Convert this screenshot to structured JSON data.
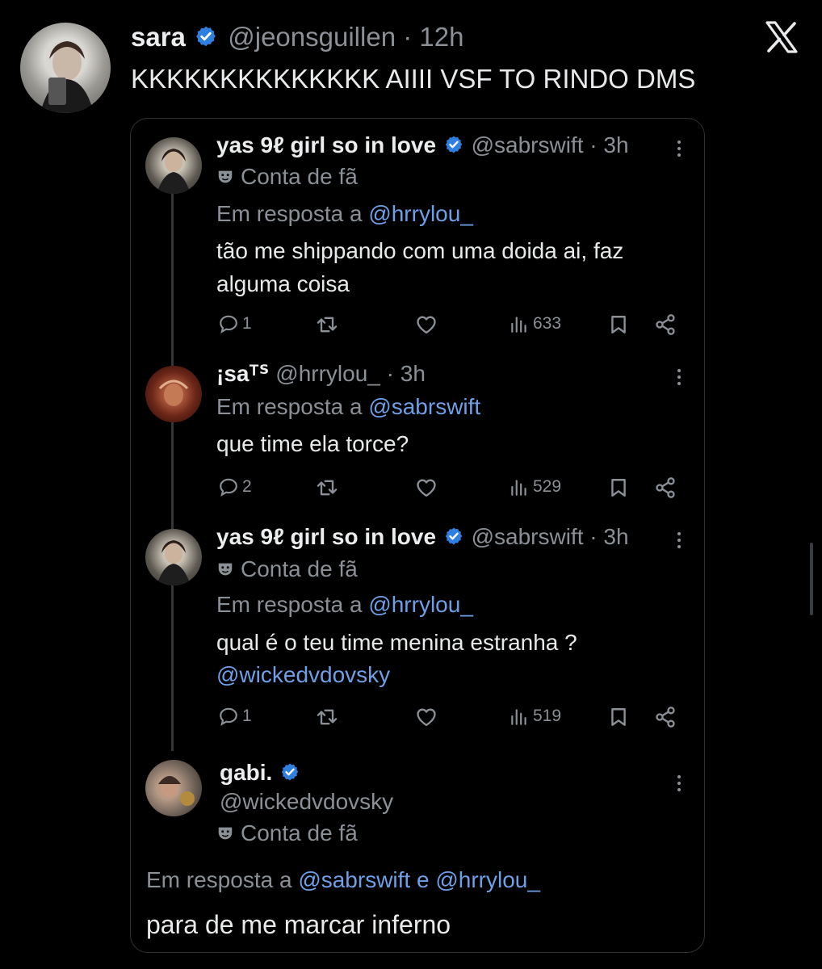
{
  "main_post": {
    "display_name": "sara",
    "handle": "@jeonsguillen",
    "time": "12h",
    "text": "KKKKKKKKKKKKKK AIIII VSF TO RINDO DMS"
  },
  "quoted_thread": [
    {
      "display_name": "yas 9ℓ girl so in love",
      "handle": "@sabrswift",
      "time": "3h",
      "badge_label": "Conta de fã",
      "reply_prefix": "Em resposta a",
      "reply_to": "@hrrylou_",
      "text_line1": "tão me shippando com uma doida ai, faz",
      "text_line2": "alguma coisa",
      "replies": "1",
      "views": "633"
    },
    {
      "display_name": "¡saᵀᔆ",
      "handle": "@hrrylou_",
      "time": "3h",
      "reply_prefix": "Em resposta a",
      "reply_to": "@sabrswift",
      "text": "que time ela torce?",
      "replies": "2",
      "views": "529"
    },
    {
      "display_name": "yas 9ℓ girl so in love",
      "handle": "@sabrswift",
      "time": "3h",
      "badge_label": "Conta de fã",
      "reply_prefix": "Em resposta a",
      "reply_to": "@hrrylou_",
      "text": "qual é o teu time menina estranha ?",
      "mention": "@wickedvdovsky",
      "replies": "1",
      "views": "519"
    },
    {
      "display_name": "gabi.",
      "handle": "@wickedvdovsky",
      "badge_label": "Conta de fã",
      "reply_prefix": "Em resposta a",
      "reply_to_1": "@sabrswift",
      "reply_conj": "e",
      "reply_to_2": "@hrrylou_",
      "text": "para de me marcar inferno"
    }
  ],
  "icons": [
    "verified-badge-icon",
    "x-logo-icon",
    "more-icon",
    "mask-icon",
    "reply-icon",
    "retweet-icon",
    "like-icon",
    "views-icon",
    "bookmark-icon",
    "share-icon"
  ],
  "colors": {
    "background": "#000000",
    "link": "#6f9fe6",
    "verified": "#2f7fe0",
    "muted": "#8b9097"
  }
}
